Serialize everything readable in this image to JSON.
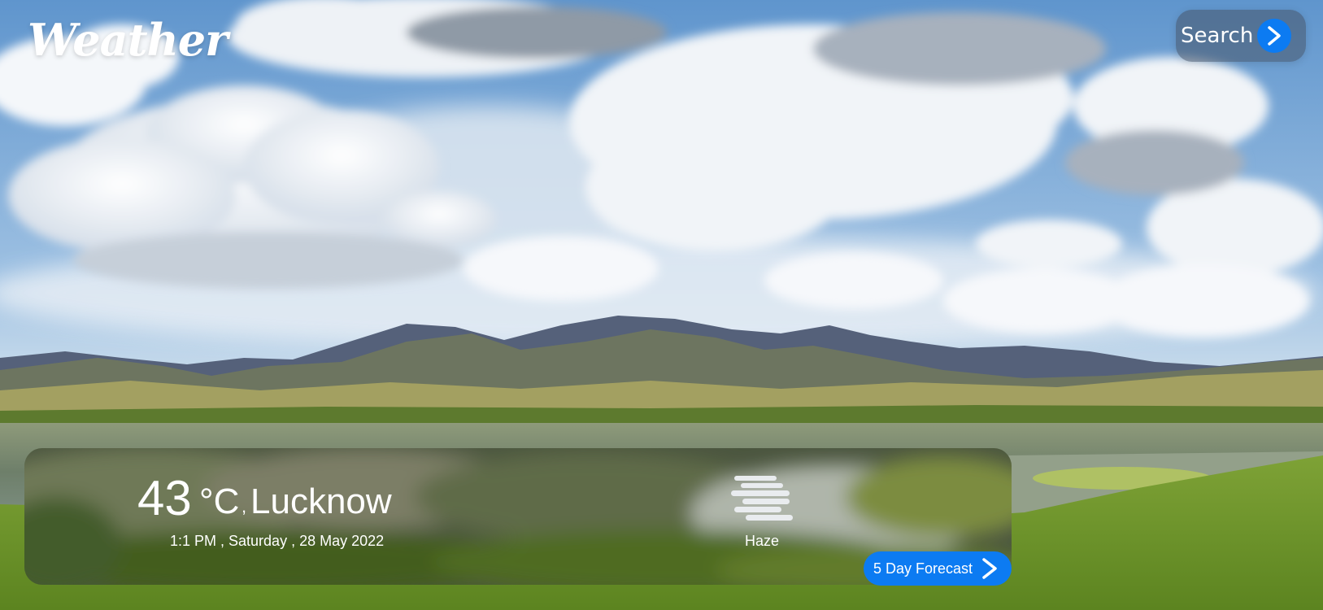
{
  "app": {
    "brand": "Weather"
  },
  "search": {
    "label": "Search",
    "go_icon": "arrow-right-icon"
  },
  "current": {
    "temperature": "43",
    "unit": "°C",
    "separator": ",",
    "city": "Lucknow",
    "datetime": "1:1 PM , Saturday , 28 May 2022",
    "condition": "Haze",
    "condition_icon": "haze-icon"
  },
  "forecast_button": {
    "label": "5 Day Forecast",
    "icon": "arrow-right-icon"
  },
  "colors": {
    "accent": "#0c7bf2",
    "text": "#ffffff"
  }
}
